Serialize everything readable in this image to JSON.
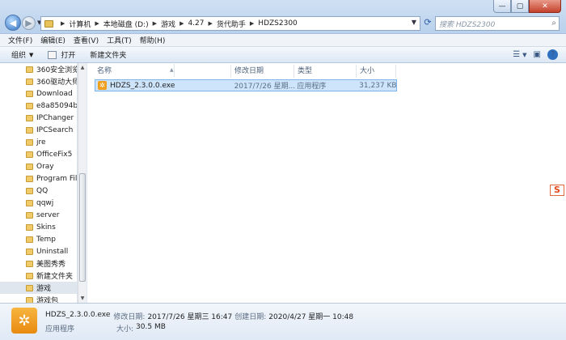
{
  "window": {
    "minimize": "—",
    "maximize": "▢",
    "close": "✕"
  },
  "address": {
    "crumbs": [
      "计算机",
      "本地磁盘 (D:)",
      "游戏",
      "4.27",
      "货代助手",
      "HDZS2300"
    ],
    "search_placeholder": "搜索 HDZS2300"
  },
  "menu": [
    "文件(F)",
    "编辑(E)",
    "查看(V)",
    "工具(T)",
    "帮助(H)"
  ],
  "toolbar": {
    "organize": "组织",
    "open": "打开",
    "new_folder": "新建文件夹"
  },
  "nav": {
    "items": [
      "360安全浏览器",
      "360驱动大师目",
      "Download",
      "e8a85094bdb",
      "IPChanger",
      "IPCSearch",
      "jre",
      "OfficeFix5",
      "Oray",
      "Program Files",
      "QQ",
      "qqwj",
      "server",
      "Skins",
      "Temp",
      "Uninstall",
      "美图秀秀",
      "新建文件夹",
      "游戏",
      "游戏包"
    ],
    "selected_index": 18
  },
  "columns": [
    "名称",
    "修改日期",
    "类型",
    "大小"
  ],
  "files": [
    {
      "name": "HDZS_2.3.0.0.exe",
      "modified": "2017/7/26 星期...",
      "type": "应用程序",
      "size": "31,237 KB"
    }
  ],
  "ime_badge": "S",
  "details": {
    "filename": "HDZS_2.3.0.0.exe",
    "modified_label": "修改日期:",
    "modified": "2017/7/26 星期三 16:47",
    "created_label": "创建日期:",
    "created": "2020/4/27 星期一 10:48",
    "type": "应用程序",
    "size_label": "大小:",
    "size": "30.5 MB"
  }
}
